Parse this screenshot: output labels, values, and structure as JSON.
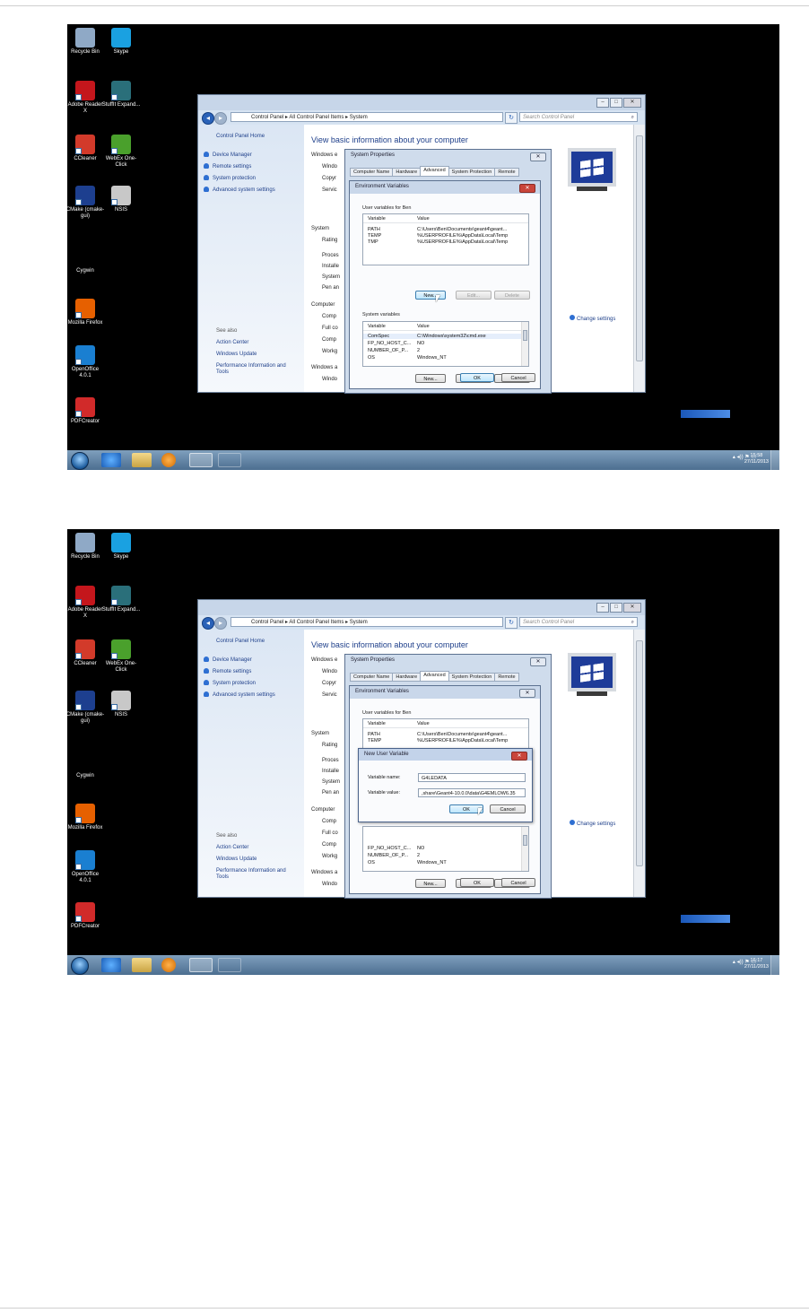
{
  "desktop": {
    "icons": [
      {
        "label": "Recycle Bin",
        "color": "#8fa9c6"
      },
      {
        "label": "Skype",
        "color": "#1aa1e1"
      },
      {
        "label": "Adobe Reader X",
        "color": "#c4161c"
      },
      {
        "label": "StuffIt Expand...",
        "color": "#2a6f7a"
      },
      {
        "label": "CCleaner",
        "color": "#d23a2a"
      },
      {
        "label": "WebEx One-Click",
        "color": "#4aa02c"
      },
      {
        "label": "CMake (cmake-gui)",
        "color": "#1d3f8f"
      },
      {
        "label": "NSIS",
        "color": "#c8c8c8"
      },
      {
        "label": "Cygwin",
        "color": "#000000"
      },
      {
        "label": "Mozilla Firefox",
        "color": "#e66000"
      },
      {
        "label": "OpenOffice 4.0.1",
        "color": "#1a7fd1"
      },
      {
        "label": "PDFCreator",
        "color": "#d12a2a"
      }
    ]
  },
  "control_panel": {
    "breadcrumb": [
      "Control Panel",
      "All Control Panel Items",
      "System"
    ],
    "search_placeholder": "Search Control Panel",
    "left_nav": {
      "home": "Control Panel Home",
      "links": [
        "Device Manager",
        "Remote settings",
        "System protection",
        "Advanced system settings"
      ],
      "see_also_title": "See also",
      "see_also": [
        "Action Center",
        "Windows Update",
        "Performance Information and Tools"
      ]
    },
    "heading": "View basic information about your computer",
    "sections": {
      "windows_edition": "Windows e",
      "edition_rows": [
        "Windo",
        "Copyr",
        "Servic"
      ],
      "system": "System",
      "system_rows": [
        "Rating",
        "Proces",
        "Installe",
        "System",
        "Pen an"
      ],
      "computer": "Computer",
      "computer_rows": [
        "Comp",
        "Full co",
        "Comp",
        "Workg"
      ],
      "windows_activation": "Windows a",
      "activation_rows": [
        "Windo"
      ]
    },
    "change_settings": "Change settings"
  },
  "system_properties": {
    "title": "System Properties",
    "tabs": [
      "Computer Name",
      "Hardware",
      "Advanced",
      "System Protection",
      "Remote"
    ],
    "active_tab": "Advanced"
  },
  "env_vars": {
    "title": "Environment Variables",
    "user_section": "User variables for Ben",
    "columns": [
      "Variable",
      "Value"
    ],
    "user_vars": [
      {
        "name": "PATH",
        "value": "C:\\Users\\Ben\\Documents\\geant4\\geant..."
      },
      {
        "name": "TEMP",
        "value": "%USERPROFILE%\\AppData\\Local\\Temp"
      },
      {
        "name": "TMP",
        "value": "%USERPROFILE%\\AppData\\Local\\Temp"
      }
    ],
    "system_section": "System variables",
    "system_vars": [
      {
        "name": "ComSpec",
        "value": "C:\\Windows\\system32\\cmd.exe"
      },
      {
        "name": "FP_NO_HOST_C...",
        "value": "NO"
      },
      {
        "name": "NUMBER_OF_P...",
        "value": "2"
      },
      {
        "name": "OS",
        "value": "Windows_NT"
      }
    ],
    "buttons": {
      "new": "New...",
      "edit": "Edit...",
      "delete": "Delete",
      "ok": "OK",
      "cancel": "Cancel"
    }
  },
  "new_user_variable": {
    "title": "New User Variable",
    "name_label": "Variable name:",
    "value_label": "Variable value:",
    "name_value": "G4LEDATA",
    "value_value": ",share\\Geant4-10.0.0\\data\\G4EMLOW6.35",
    "ok": "OK",
    "cancel": "Cancel"
  },
  "taskbar": {
    "tray_glyphs": "▴ ◂)) ⚑ ▭",
    "screens": [
      {
        "time": "15:58",
        "date": "27/11/2013"
      },
      {
        "time": "16:17",
        "date": "27/11/2013"
      }
    ]
  }
}
